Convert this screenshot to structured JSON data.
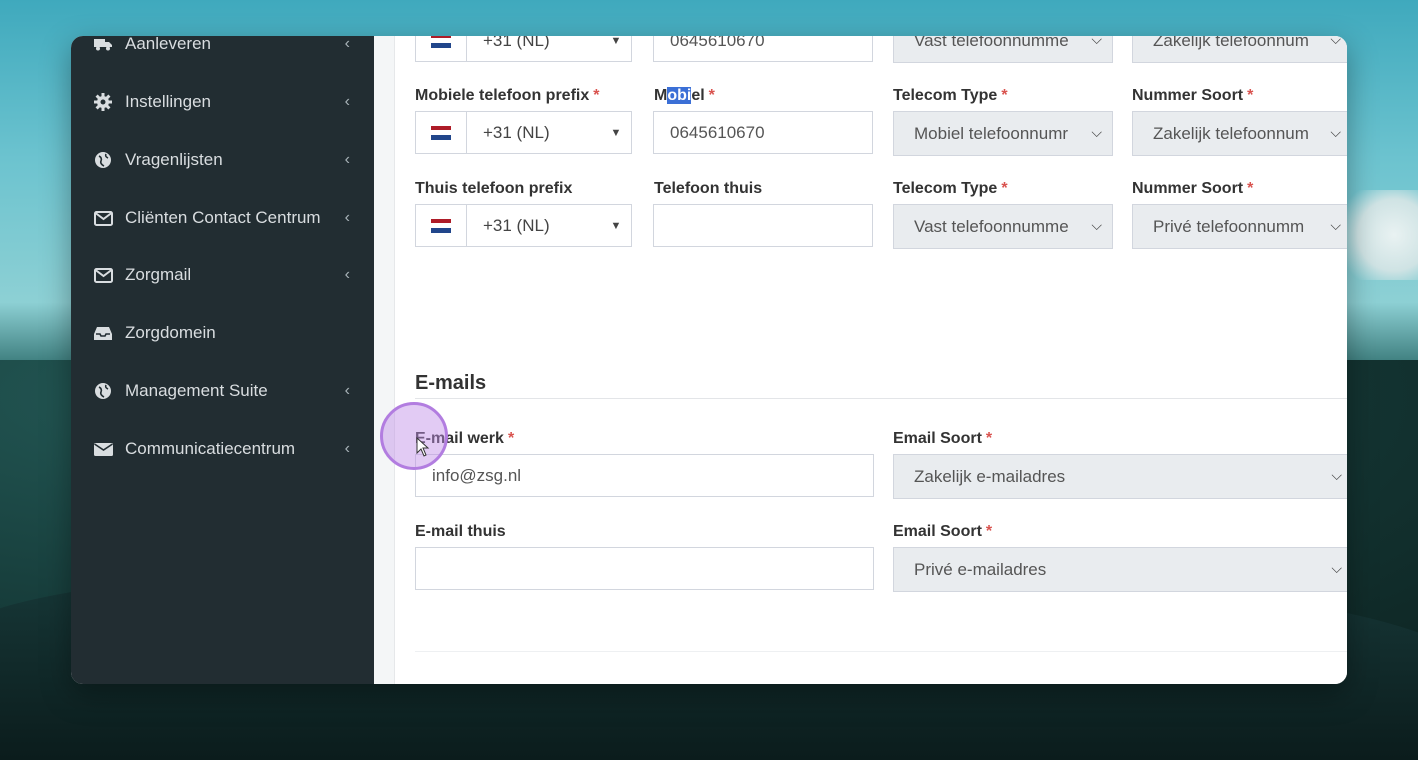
{
  "sidebar": {
    "items": [
      {
        "label": "Aanleveren",
        "icon": "truck-icon"
      },
      {
        "label": "Instellingen",
        "icon": "gear-icon"
      },
      {
        "label": "Vragenlijsten",
        "icon": "globe-icon"
      },
      {
        "label": "Cliënten Contact Centrum",
        "icon": "envelope-icon"
      },
      {
        "label": "Zorgmail",
        "icon": "envelope-icon"
      },
      {
        "label": "Zorgdomein",
        "icon": "inbox-icon"
      },
      {
        "label": "Management Suite",
        "icon": "globe-icon"
      },
      {
        "label": "Communicatiecentrum",
        "icon": "envelope-filled-icon"
      }
    ],
    "chevron": "‹"
  },
  "phones": {
    "row0": {
      "prefix_value": "+31 (NL)",
      "number_value": "0645610670",
      "telecom_type": "Vast telefoonnumme",
      "nummer_soort": "Zakelijk telefoonnum"
    },
    "row1": {
      "prefix_label": "Mobiele telefoon prefix",
      "number_label_pre": "M",
      "number_label_hl": "obi",
      "number_label_post": "el",
      "telecom_label": "Telecom Type",
      "soort_label": "Nummer Soort",
      "prefix_value": "+31 (NL)",
      "number_value": "0645610670",
      "telecom_type": "Mobiel telefoonnumr",
      "nummer_soort": "Zakelijk telefoonnum"
    },
    "row2": {
      "prefix_label": "Thuis telefoon prefix",
      "number_label": "Telefoon thuis",
      "telecom_label": "Telecom Type",
      "soort_label": "Nummer Soort",
      "prefix_value": "+31 (NL)",
      "number_value": "",
      "telecom_type": "Vast telefoonnumme",
      "nummer_soort": "Privé telefoonnumm"
    },
    "required_mark": "*"
  },
  "emails": {
    "title": "E-mails",
    "work_label": "E-mail werk",
    "work_value": "info@zsg.nl",
    "work_soort_label": "Email Soort",
    "work_soort_value": "Zakelijk e-mailadres",
    "home_label": "E-mail thuis",
    "home_value": "",
    "home_soort_label": "Email Soort",
    "home_soort_value": "Privé e-mailadres"
  },
  "colors": {
    "sidebar_bg": "#222d32",
    "required": "#d9534f",
    "highlight": "#3b6fd6",
    "cursor_ring": "#b27de0"
  }
}
